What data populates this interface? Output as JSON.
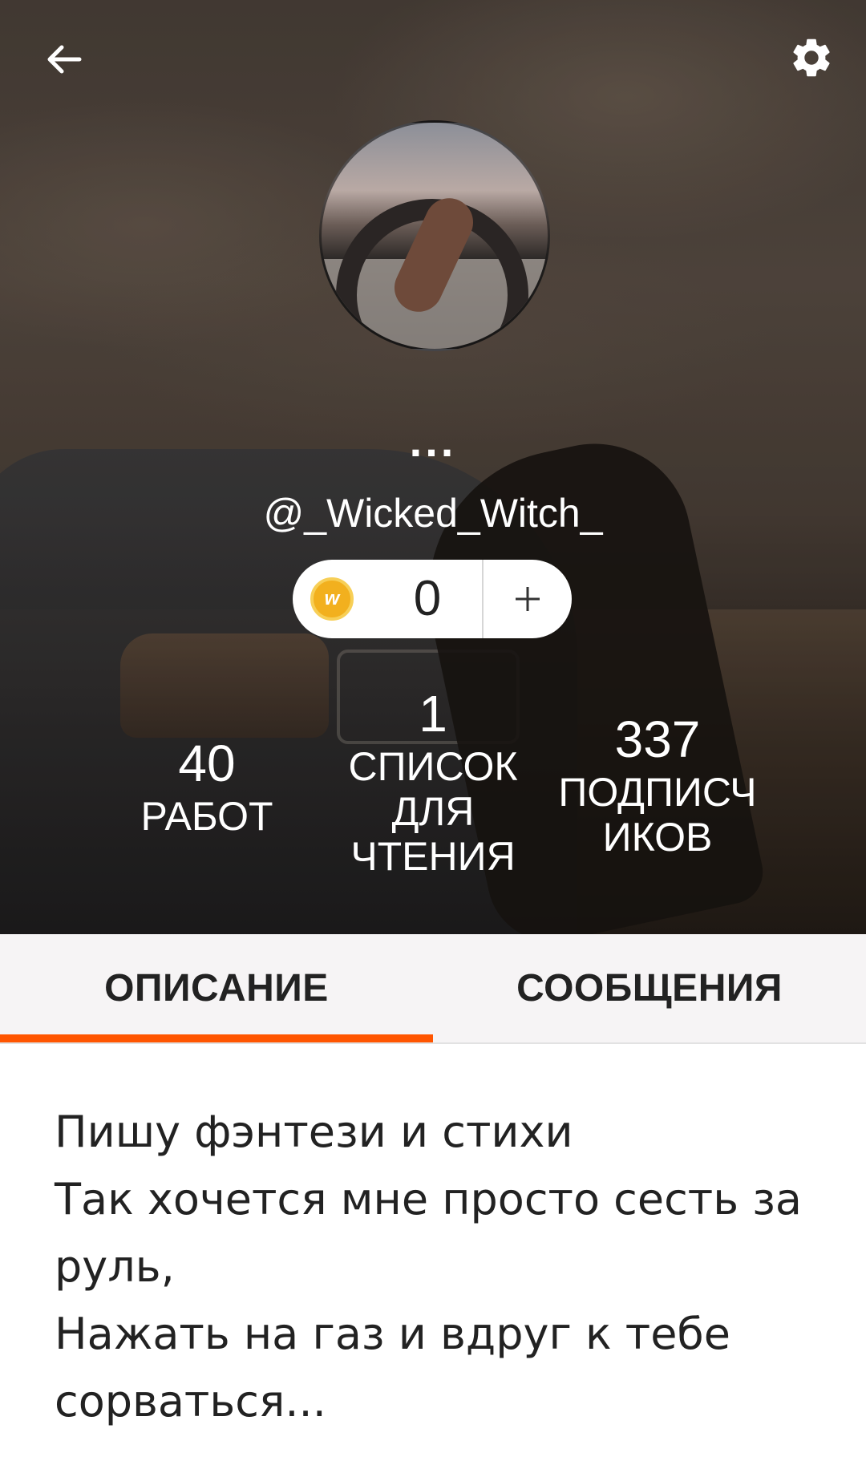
{
  "header": {
    "back_icon": "arrow-left-icon",
    "settings_icon": "gear-icon"
  },
  "profile": {
    "display_name": "...",
    "username": "@_Wicked_Witch_"
  },
  "coins": {
    "count": "0",
    "add_label": "+",
    "icon": "wattpad-coin-icon",
    "icon_letter": "w"
  },
  "stats": {
    "works": {
      "value": "40",
      "label": "РАБОТ"
    },
    "reading_lists": {
      "value": "1",
      "label_lines": [
        "СПИСОК",
        "ДЛЯ",
        "ЧТЕНИЯ"
      ]
    },
    "followers": {
      "value": "337",
      "label_lines": [
        "ПОДПИСЧ",
        "ИКОВ"
      ]
    }
  },
  "tabs": [
    {
      "label": "ОПИСАНИЕ",
      "active": true
    },
    {
      "label": "СООБЩЕНИЯ",
      "active": false
    }
  ],
  "description": {
    "lines": [
      "Пишу фэнтези и стихи",
      "Так хочется мне просто сесть за руль,",
      "Нажать на газ и вдруг к тебе сорваться..."
    ]
  },
  "colors": {
    "accent": "#ff5500",
    "coin": "#f2b01e"
  }
}
